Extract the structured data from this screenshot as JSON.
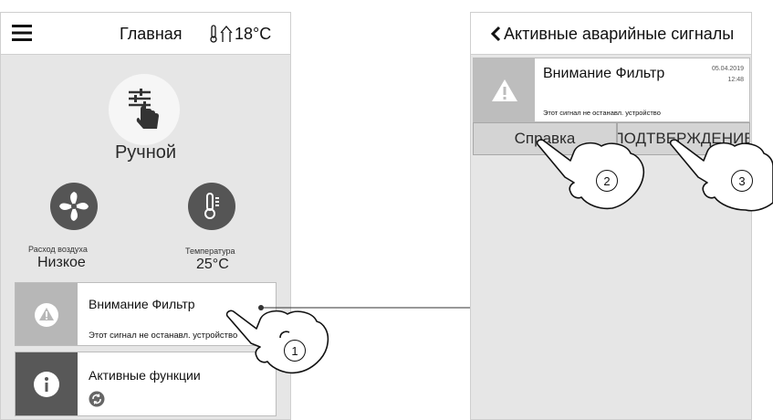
{
  "home": {
    "title": "Главная",
    "temperature": "18°C",
    "mode": "Ручной",
    "airflow": {
      "label": "Расход воздуха",
      "value": "Низкое"
    },
    "temp_widget": {
      "label": "Температура",
      "value": "25°C"
    },
    "alarm_card": {
      "title": "Внимание Фильтр",
      "subtitle": "Этот сигнал не останавл. устройство"
    },
    "functions_card": {
      "title": "Активные функции"
    }
  },
  "alarms": {
    "title": "Активные аварийные сигналы",
    "item": {
      "title": "Внимание Фильтр",
      "date": "05.04.2019",
      "time": "12:48",
      "subtitle": "Этот сигнал не останавл. устройство"
    },
    "help_button": "Справка",
    "confirm_button": "ПОДТВЕРЖДЕНИЕ"
  },
  "callouts": [
    "1",
    "2",
    "3"
  ]
}
